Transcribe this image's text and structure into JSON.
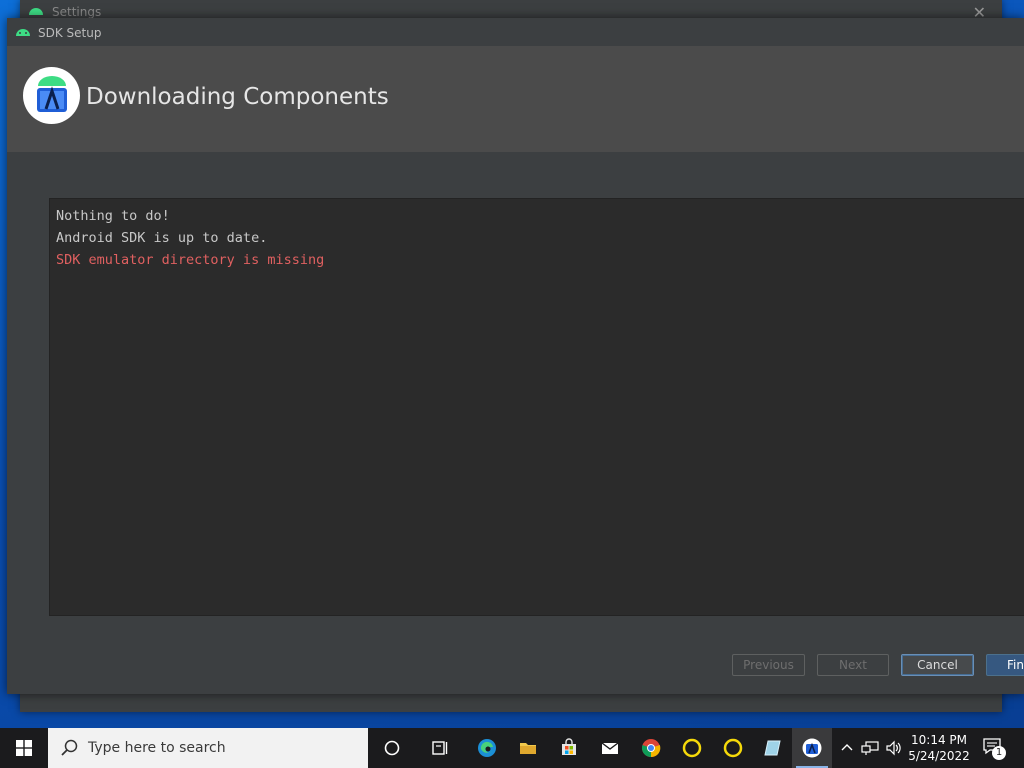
{
  "background_window": {
    "title": "Settings"
  },
  "dialog": {
    "title": "SDK Setup",
    "header_title": "Downloading Components",
    "console_lines": [
      "Nothing to do!",
      "Android SDK is up to date.",
      "SDK emulator directory is missing"
    ],
    "buttons": {
      "previous": "Previous",
      "next": "Next",
      "cancel": "Cancel",
      "finish": "Fini"
    }
  },
  "taskbar": {
    "search_placeholder": "Type here to search",
    "clock_time": "10:14 PM",
    "clock_date": "5/24/2022",
    "notification_count": "1"
  },
  "colors": {
    "dialog_bg": "#3c3f41",
    "header_bg": "#4b4b4b",
    "console_bg": "#2b2b2b",
    "error_text": "#e06060",
    "finish_button": "#365880",
    "taskbar_bg": "#1b1b1d"
  }
}
